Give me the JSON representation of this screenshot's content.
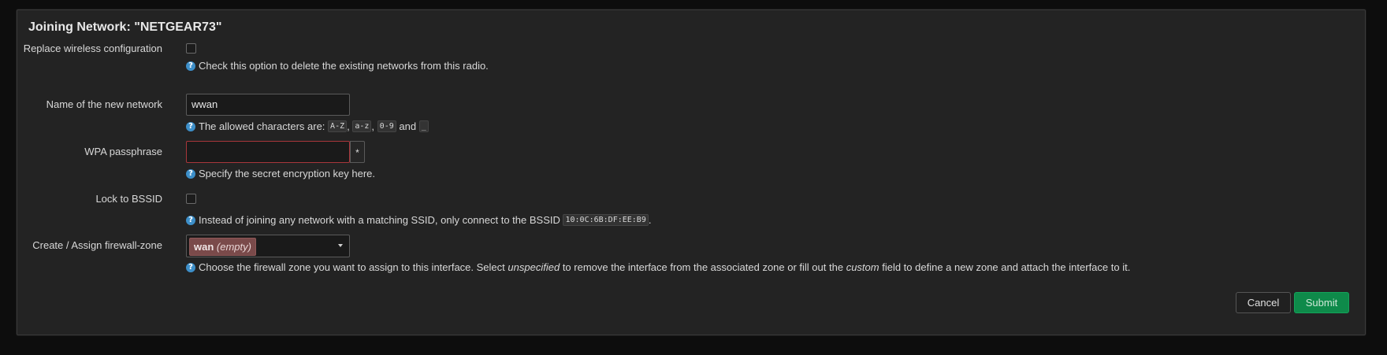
{
  "dialog": {
    "title": "Joining Network: \"NETGEAR73\""
  },
  "fields": {
    "replace": {
      "label": "Replace wireless configuration",
      "help": "Check this option to delete the existing networks from this radio.",
      "checked": false
    },
    "name": {
      "label": "Name of the new network",
      "value": "wwan",
      "help_prefix": "The allowed characters are:",
      "codes": [
        "A-Z",
        "a-z",
        "0-9",
        "_"
      ],
      "sep1": ",",
      "sep2": ",",
      "and_text": "and"
    },
    "wpa": {
      "label": "WPA passphrase",
      "value": "",
      "reveal_glyph": "*",
      "help": "Specify the secret encryption key here."
    },
    "lock_bssid": {
      "label": "Lock to BSSID",
      "checked": false,
      "help_prefix": "Instead of joining any network with a matching SSID, only connect to the BSSID",
      "bssid": "10:0C:6B:DF:EE:B9",
      "help_suffix": "."
    },
    "firewall": {
      "label": "Create / Assign firewall-zone",
      "zone_name": "wan",
      "zone_empty": "(empty)",
      "help_1": "Choose the firewall zone you want to assign to this interface. Select",
      "help_em1": "unspecified",
      "help_2": "to remove the interface from the associated zone or fill out the",
      "help_em2": "custom",
      "help_3": "field to define a new zone and attach the interface to it."
    }
  },
  "help_icon_glyph": "?",
  "buttons": {
    "cancel": "Cancel",
    "submit": "Submit"
  },
  "colors": {
    "accent_submit": "#0e8a4a",
    "invalid_border": "#a8363b",
    "help_icon": "#3d8fc9",
    "zone_badge": "#7a4a4a"
  }
}
